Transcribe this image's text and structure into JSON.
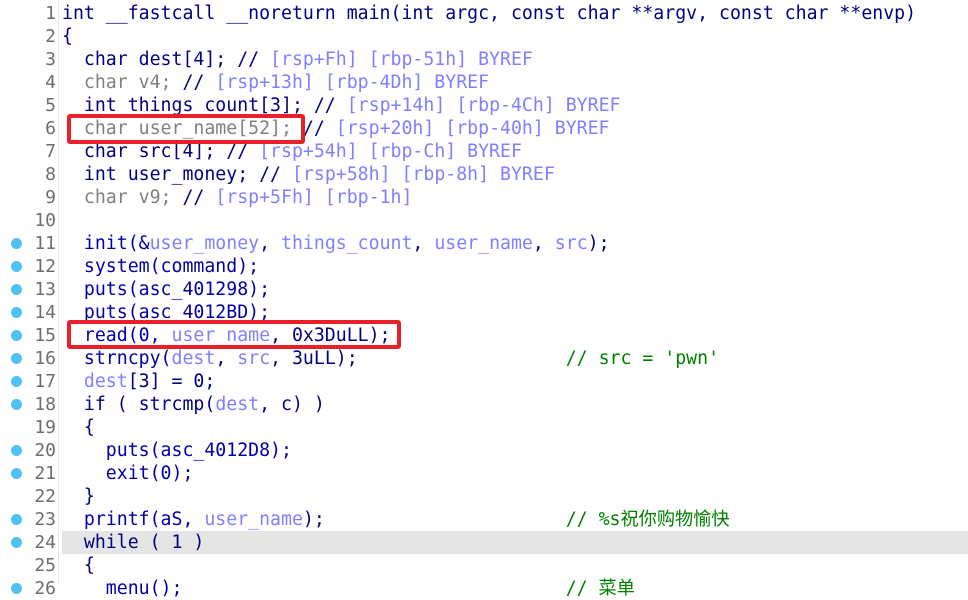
{
  "editor": {
    "highlighted_line": 24,
    "colors": {
      "keyword": "#000080",
      "local_var": "#8080ff",
      "comment": "#008000",
      "breakpoint": "#4fc1f5",
      "annotation_box": "#e8202a"
    },
    "lines": [
      {
        "n": "1",
        "dot": false,
        "t": [
          [
            "kw",
            "int __fastcall __noreturn main(int argc, const char **argv, const char **envp)"
          ]
        ]
      },
      {
        "n": "2",
        "dot": false,
        "t": [
          [
            "p",
            "{"
          ]
        ]
      },
      {
        "n": "3",
        "dot": false,
        "t": [
          [
            "kw",
            "  char dest[4]; "
          ],
          [
            "kw",
            "// "
          ],
          [
            "cmt",
            "[rsp+Fh] [rbp-51h] BYREF"
          ]
        ]
      },
      {
        "n": "4",
        "dot": false,
        "t": [
          [
            "gray",
            "  char v4; "
          ],
          [
            "kw",
            "// "
          ],
          [
            "cmt",
            "[rsp+13h] [rbp-4Dh] BYREF"
          ]
        ]
      },
      {
        "n": "5",
        "dot": false,
        "t": [
          [
            "kw",
            "  int things_count[3]; "
          ],
          [
            "kw",
            "// "
          ],
          [
            "cmt",
            "[rsp+14h] [rbp-4Ch] BYREF"
          ]
        ]
      },
      {
        "n": "6",
        "dot": false,
        "t": [
          [
            "gray",
            "  char user_name[52]; "
          ],
          [
            "kw",
            "// "
          ],
          [
            "cmt",
            "[rsp+20h] [rbp-40h] BYREF"
          ]
        ]
      },
      {
        "n": "7",
        "dot": false,
        "t": [
          [
            "kw",
            "  char src[4]; "
          ],
          [
            "kw",
            "// "
          ],
          [
            "cmt",
            "[rsp+54h] [rbp-Ch] BYREF"
          ]
        ]
      },
      {
        "n": "8",
        "dot": false,
        "t": [
          [
            "kw",
            "  int user_money; "
          ],
          [
            "kw",
            "// "
          ],
          [
            "cmt",
            "[rsp+58h] [rbp-8h] BYREF"
          ]
        ]
      },
      {
        "n": "9",
        "dot": false,
        "t": [
          [
            "gray",
            "  char v9; "
          ],
          [
            "kw",
            "// "
          ],
          [
            "cmt",
            "[rsp+5Fh] [rbp-1h]"
          ]
        ]
      },
      {
        "n": "10",
        "dot": false,
        "t": []
      },
      {
        "n": "11",
        "dot": true,
        "t": [
          [
            "fn",
            "  init(&"
          ],
          [
            "var",
            "user_money"
          ],
          [
            "p",
            ", "
          ],
          [
            "var",
            "things_count"
          ],
          [
            "p",
            ", "
          ],
          [
            "var",
            "user_name"
          ],
          [
            "p",
            ", "
          ],
          [
            "var",
            "src"
          ],
          [
            "p",
            ");"
          ]
        ]
      },
      {
        "n": "12",
        "dot": true,
        "t": [
          [
            "fn",
            "  system(command);"
          ]
        ]
      },
      {
        "n": "13",
        "dot": true,
        "t": [
          [
            "fn",
            "  puts(asc_401298);"
          ]
        ]
      },
      {
        "n": "14",
        "dot": true,
        "t": [
          [
            "fn",
            "  puts(asc_4012BD);"
          ]
        ]
      },
      {
        "n": "15",
        "dot": true,
        "t": [
          [
            "fn",
            "  read(0, "
          ],
          [
            "var",
            "user_name"
          ],
          [
            "p",
            ", 0x3DuLL);"
          ]
        ]
      },
      {
        "n": "16",
        "dot": true,
        "t": [
          [
            "fn",
            "  strncpy("
          ],
          [
            "var",
            "dest"
          ],
          [
            "p",
            ", "
          ],
          [
            "var",
            "src"
          ],
          [
            "p",
            ", 3uLL);                   "
          ],
          [
            "cm2",
            "// src = 'pwn'"
          ]
        ]
      },
      {
        "n": "17",
        "dot": true,
        "t": [
          [
            "var",
            "  dest"
          ],
          [
            "p",
            "[3] = 0;"
          ]
        ]
      },
      {
        "n": "18",
        "dot": true,
        "t": [
          [
            "kw",
            "  if ( strcmp("
          ],
          [
            "var",
            "dest"
          ],
          [
            "p",
            ", c) )"
          ]
        ]
      },
      {
        "n": "19",
        "dot": false,
        "t": [
          [
            "p",
            "  {"
          ]
        ]
      },
      {
        "n": "20",
        "dot": true,
        "t": [
          [
            "fn",
            "    puts(asc_4012D8);"
          ]
        ]
      },
      {
        "n": "21",
        "dot": true,
        "t": [
          [
            "fn",
            "    exit(0);"
          ]
        ]
      },
      {
        "n": "22",
        "dot": false,
        "t": [
          [
            "p",
            "  }"
          ]
        ]
      },
      {
        "n": "23",
        "dot": true,
        "t": [
          [
            "fn",
            "  printf(aS, "
          ],
          [
            "var",
            "user_name"
          ],
          [
            "p",
            ");                      "
          ],
          [
            "cm2",
            "// %s祝你购物愉快"
          ]
        ]
      },
      {
        "n": "24",
        "dot": true,
        "t": [
          [
            "kw",
            "  while ( 1 )"
          ]
        ]
      },
      {
        "n": "25",
        "dot": false,
        "t": [
          [
            "p",
            "  {"
          ]
        ]
      },
      {
        "n": "26",
        "dot": true,
        "t": [
          [
            "fn",
            "    menu();                                   "
          ],
          [
            "cm2",
            "// 菜单"
          ]
        ]
      }
    ]
  }
}
